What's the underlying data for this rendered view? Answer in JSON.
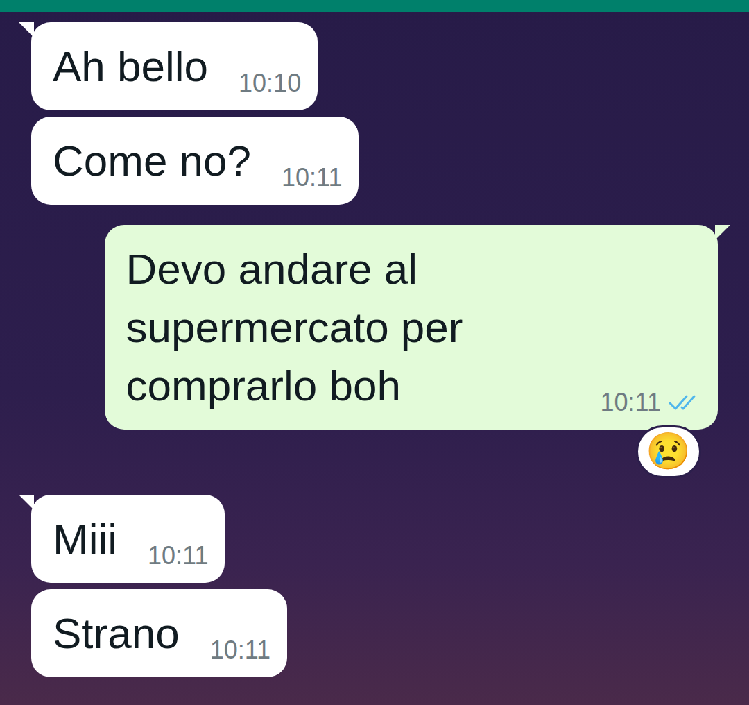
{
  "chat": {
    "messages": [
      {
        "kind": "incoming",
        "text": "Ah bello",
        "time": "10:10",
        "tail": true
      },
      {
        "kind": "incoming",
        "text": "Come no?",
        "time": "10:11",
        "tail": false
      },
      {
        "kind": "outgoing",
        "text": "Devo andare al supermercato per comprarlo boh",
        "time": "10:11",
        "tail": true,
        "read": true,
        "reaction": "😢"
      },
      {
        "kind": "incoming",
        "text": "Miii",
        "time": "10:11",
        "tail": true
      },
      {
        "kind": "incoming",
        "text": "Strano",
        "time": "10:11",
        "tail": false
      }
    ]
  }
}
